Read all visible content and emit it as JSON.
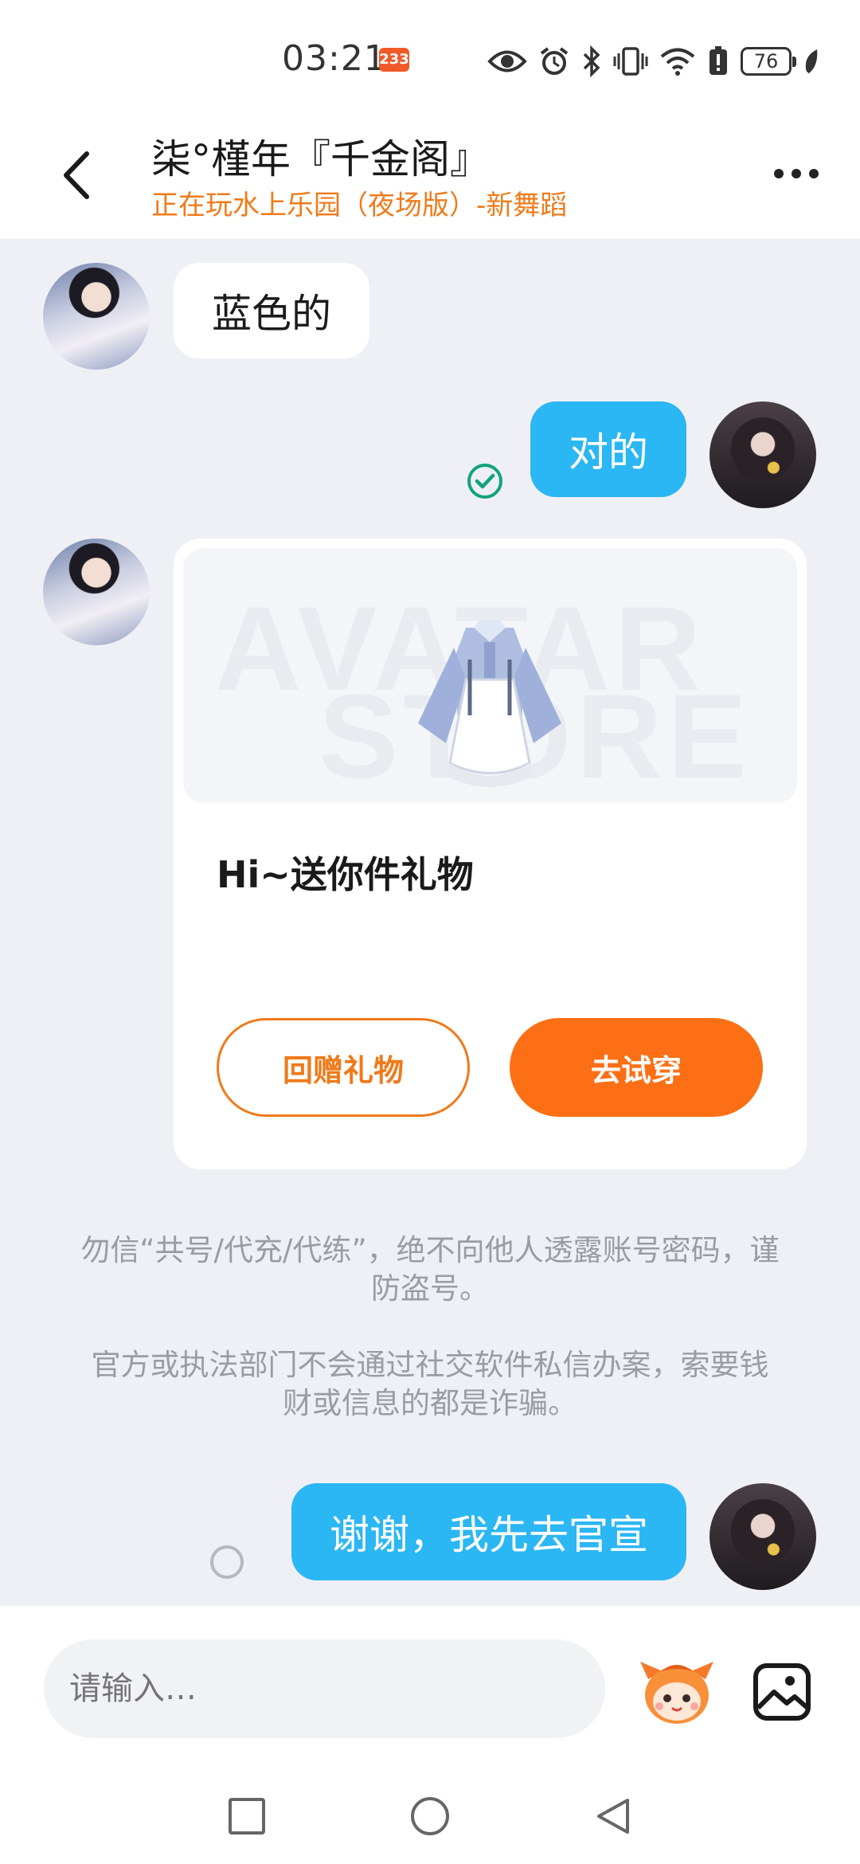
{
  "status_bar": {
    "time": "03:21",
    "badge": "233",
    "battery": "76",
    "icons": [
      "eye-icon",
      "alarm-icon",
      "bluetooth-icon",
      "vibrate-icon",
      "wifi-icon",
      "battery-alert-icon",
      "battery-icon",
      "leaf-icon"
    ]
  },
  "header": {
    "title": "柒°槿年『千金阁』",
    "subtitle": "正在玩水上乐园（夜场版）-新舞蹈",
    "subtitle_color": "#f07a1a"
  },
  "messages": {
    "m1": "蓝色的",
    "m2": "对的",
    "m3": "谢谢，我先去官宣"
  },
  "gift_card": {
    "watermark_line1": "AVATAR",
    "watermark_line2": "STORE",
    "message": "Hi~送你件礼物",
    "return_label": "回赠礼物",
    "try_label": "去试穿",
    "accent": "#fc6f15"
  },
  "notices": {
    "n1": "勿信“共号/代充/代练”，绝不向他人透露账号密码，谨防盗号。",
    "n2": "官方或执法部门不会通过社交软件私信办案，索要钱财或信息的都是诈骗。"
  },
  "input": {
    "placeholder": "请输入…"
  },
  "colors": {
    "bubble_out": "#2bb6f4",
    "background": "#eef0f5",
    "read_check": "#12a37a"
  }
}
